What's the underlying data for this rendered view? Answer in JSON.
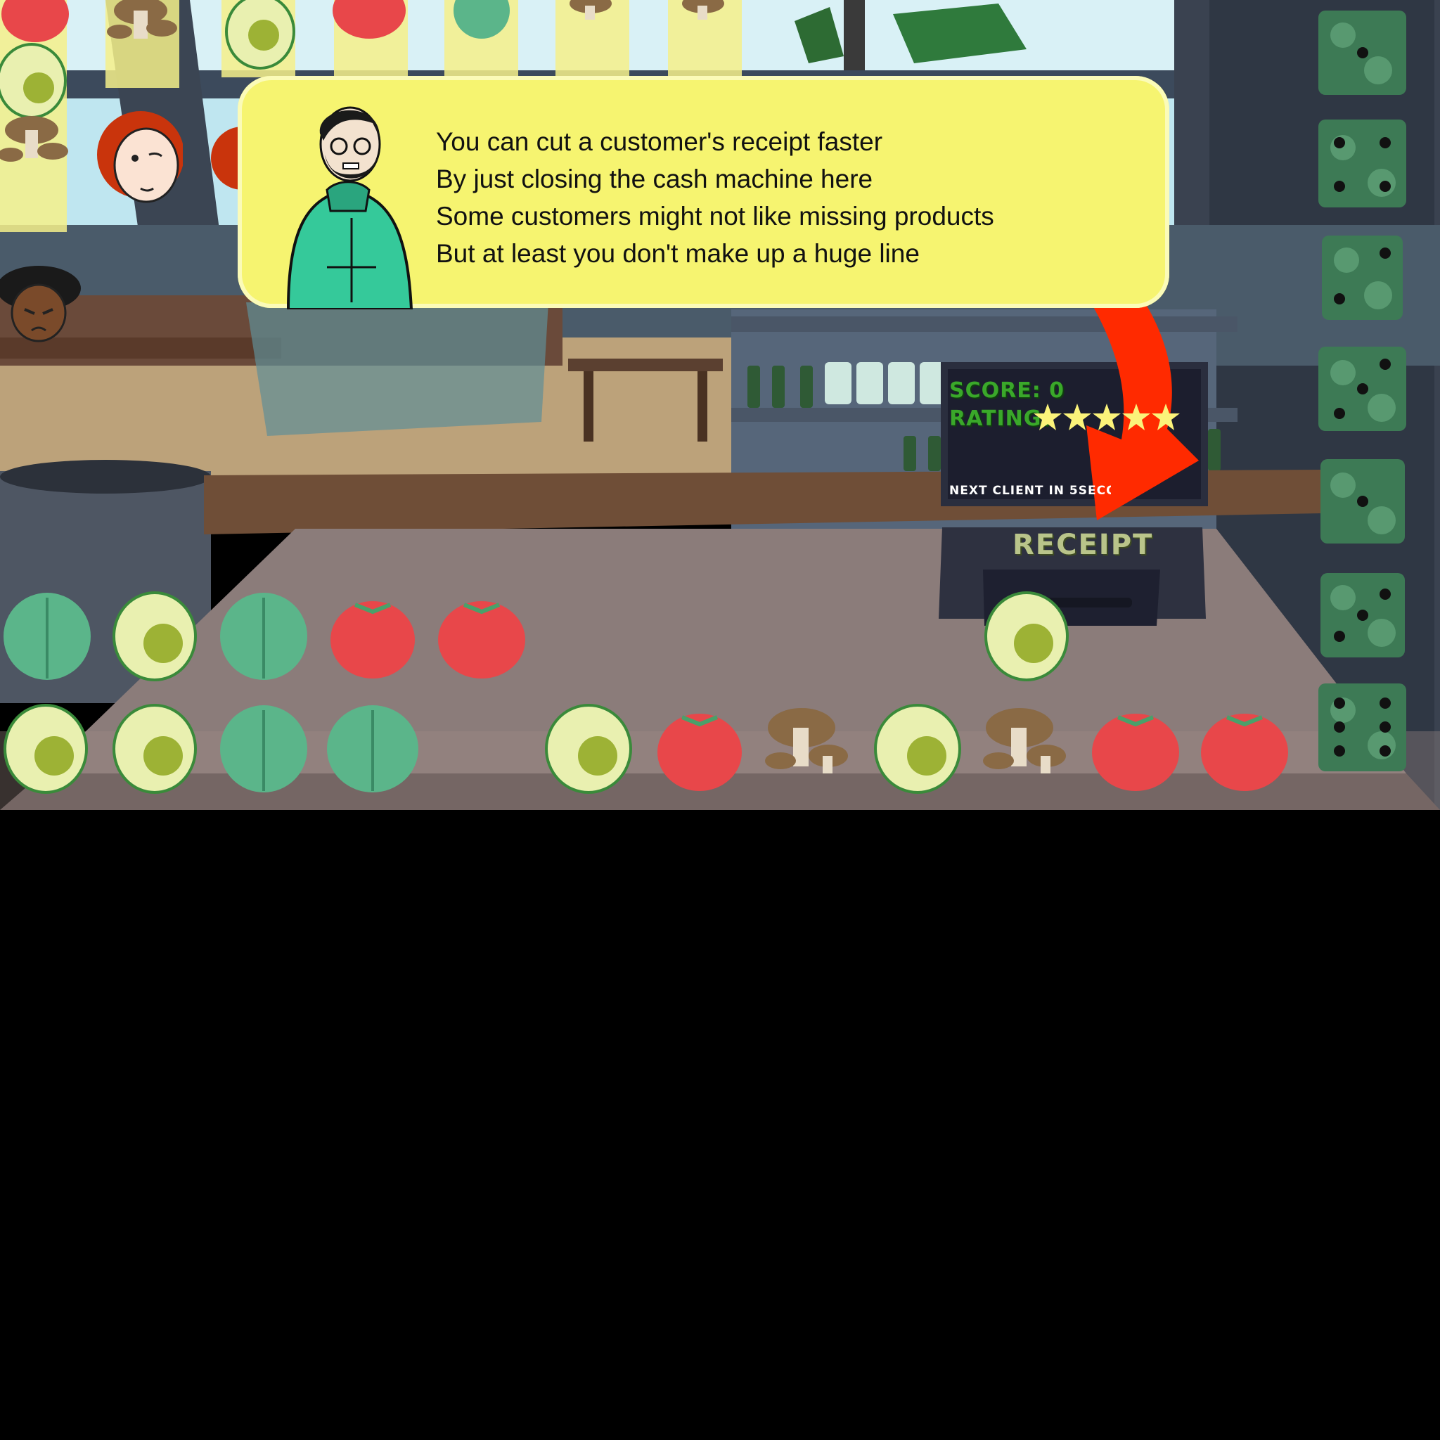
{
  "tutorial": {
    "lines": [
      "You can cut a customer's receipt faster",
      "By just closing the cash machine here",
      "Some customers might not like missing products",
      "But at least you don't make up a huge line"
    ]
  },
  "monitor": {
    "score_label": "SCORE: 0",
    "rating_label": "RATING:",
    "rating_stars": 5,
    "next_client": "NEXT CLIENT IN 5SECO"
  },
  "register": {
    "receipt_label": "RECEIPT"
  },
  "colors": {
    "dialog_bg": "#f6f470",
    "arrow": "#ff2a00",
    "tomato": "#e8474a",
    "avocado_skin": "#e9f0b0",
    "avocado_pit": "#9db235",
    "lettuce": "#5bb58a",
    "mushroom_cap": "#8a6a45"
  },
  "counter_items": {
    "row1": [
      "lettuce",
      "avocado",
      "lettuce",
      "tomato",
      "tomato"
    ],
    "row2": [
      "avocado",
      "avocado",
      "lettuce",
      "lettuce",
      "avocado",
      "tomato",
      "mushroom",
      "avocado",
      "mushroom",
      "tomato",
      "tomato"
    ],
    "bagging": [
      "avocado"
    ]
  },
  "dice_column": [
    1,
    4,
    2,
    3,
    1,
    3,
    6
  ],
  "customers": [
    "customer-redhead",
    "customer-redhead",
    "customer-hat"
  ]
}
